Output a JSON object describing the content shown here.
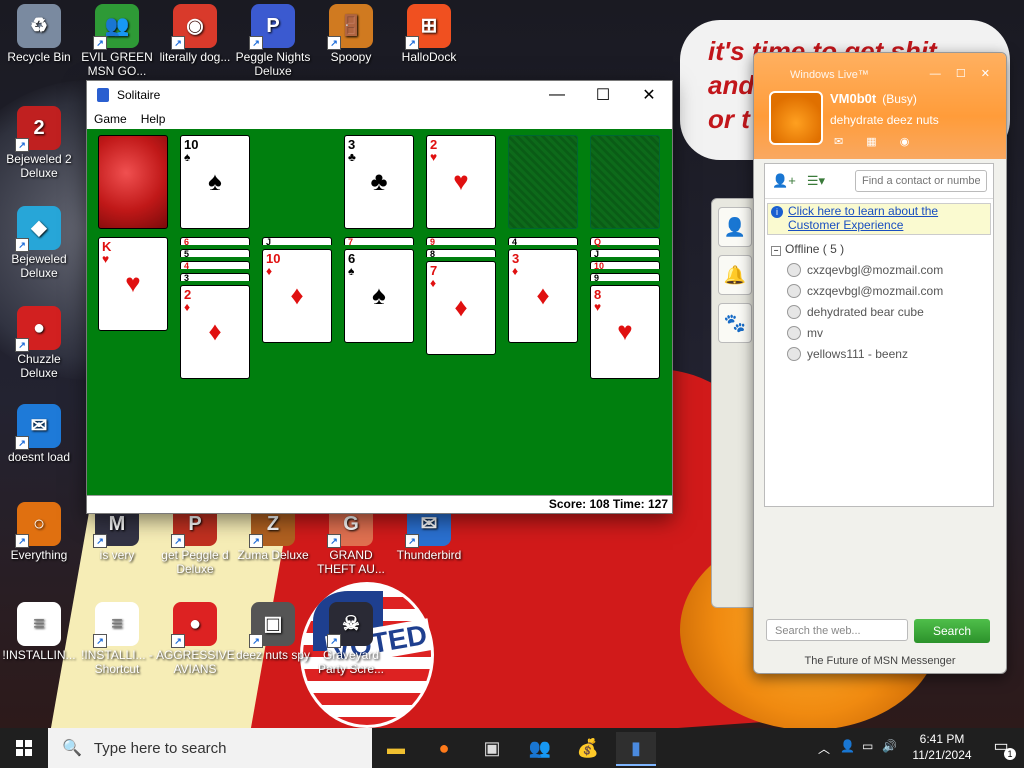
{
  "desktop": {
    "background_text": [
      "it's time to get shit",
      "and",
      "or t"
    ],
    "voted_sticker": "VOTED",
    "icons": [
      {
        "id": "recycle",
        "label": "Recycle Bin",
        "color": "#7a8aa0",
        "glyph": "♻"
      },
      {
        "id": "evil-green",
        "label": "EVIL GREEN MSN GO...",
        "color": "#2e9a36",
        "glyph": "👥"
      },
      {
        "id": "chrome",
        "label": "literally dog...",
        "color": "#d93a2b",
        "glyph": "◉"
      },
      {
        "id": "peggle-nights",
        "label": "Peggle Nights Deluxe",
        "color": "#3b5ad0",
        "glyph": "P"
      },
      {
        "id": "spoopy",
        "label": "Spoopy",
        "color": "#d07a20",
        "glyph": "🚪"
      },
      {
        "id": "hallodock",
        "label": "HalloDock",
        "color": "#f05020",
        "glyph": "⊞"
      },
      {
        "id": "bejeweled2",
        "label": "Bejeweled 2 Deluxe",
        "color": "#c02020",
        "glyph": "2"
      },
      {
        "id": "bejeweled",
        "label": "Bejeweled Deluxe",
        "color": "#27a6d8",
        "glyph": "◆"
      },
      {
        "id": "chuzzle",
        "label": "Chuzzle Deluxe",
        "color": "#d22020",
        "glyph": "●"
      },
      {
        "id": "doesnt-load",
        "label": "doesnt load",
        "color": "#1e7ad8",
        "glyph": "✉"
      },
      {
        "id": "everything",
        "label": "Everything",
        "color": "#e07010",
        "glyph": "○"
      },
      {
        "id": "is-very",
        "label": "is very",
        "color": "#334",
        "glyph": "M"
      },
      {
        "id": "get-peggle",
        "label": "get Peggle d Deluxe",
        "color": "#c03020",
        "glyph": "P"
      },
      {
        "id": "zuma",
        "label": "Zuma Deluxe",
        "color": "#b06020",
        "glyph": "Z"
      },
      {
        "id": "gta",
        "label": "GRAND THEFT AU...",
        "color": "#e07050",
        "glyph": "G"
      },
      {
        "id": "thunderbird",
        "label": "Thunderbird",
        "color": "#2a70d0",
        "glyph": "✉"
      },
      {
        "id": "installing1",
        "label": "!INSTALLIN...",
        "color": "#ffffff",
        "glyph": "≡"
      },
      {
        "id": "installing2",
        "label": "!INSTALLI... - Shortcut",
        "color": "#ffffff",
        "glyph": "≡"
      },
      {
        "id": "aggressive-avians",
        "label": "AGGRESSIVE AVIANS",
        "color": "#d22",
        "glyph": "●"
      },
      {
        "id": "deez-nuts-spy",
        "label": "deez nuts spy",
        "color": "#555",
        "glyph": "▣"
      },
      {
        "id": "graveyard",
        "label": "Graveyard Party Scre...",
        "color": "#2a2a35",
        "glyph": "☠"
      }
    ]
  },
  "solitaire": {
    "title": "Solitaire",
    "menu": [
      "Game",
      "Help"
    ],
    "status": "Score: 108 Time: 127",
    "waste_top": {
      "rank": "10",
      "suit": "♠",
      "color": "blk"
    },
    "foundations": [
      {
        "rank": "3",
        "suit": "♣",
        "color": "blk"
      },
      {
        "rank": "2",
        "suit": "♥",
        "color": "red"
      }
    ],
    "tableau": [
      {
        "tops": [],
        "face": {
          "rank": "K",
          "suit": "♥",
          "color": "red"
        }
      },
      {
        "tops": [
          {
            "rank": "6",
            "suit": "♥",
            "color": "red"
          },
          {
            "rank": "5",
            "suit": "♠",
            "color": "blk"
          },
          {
            "rank": "4",
            "suit": "♦",
            "color": "red"
          },
          {
            "rank": "3",
            "suit": "♠",
            "color": "blk"
          }
        ],
        "face": {
          "rank": "2",
          "suit": "♦",
          "color": "red"
        }
      },
      {
        "tops": [
          {
            "rank": "J",
            "suit": "♣",
            "color": "blk"
          }
        ],
        "face": {
          "rank": "10",
          "suit": "♦",
          "color": "red"
        }
      },
      {
        "tops": [
          {
            "rank": "7",
            "suit": "♥",
            "color": "red"
          }
        ],
        "face": {
          "rank": "6",
          "suit": "♠",
          "color": "blk"
        }
      },
      {
        "tops": [
          {
            "rank": "9",
            "suit": "♦",
            "color": "red"
          },
          {
            "rank": "8",
            "suit": "♠",
            "color": "blk"
          }
        ],
        "face": {
          "rank": "7",
          "suit": "♦",
          "color": "red"
        }
      },
      {
        "tops": [
          {
            "rank": "4",
            "suit": "♠",
            "color": "blk"
          }
        ],
        "face": {
          "rank": "3",
          "suit": "♦",
          "color": "red"
        }
      },
      {
        "tops": [
          {
            "rank": "Q",
            "suit": "♥",
            "color": "red"
          },
          {
            "rank": "J",
            "suit": "♠",
            "color": "blk"
          },
          {
            "rank": "10",
            "suit": "♥",
            "color": "red"
          },
          {
            "rank": "9",
            "suit": "♠",
            "color": "blk"
          }
        ],
        "face": {
          "rank": "8",
          "suit": "♥",
          "color": "red"
        }
      }
    ]
  },
  "msn": {
    "window_title": "Windows Live™",
    "name": "VM0b0t",
    "status": "(Busy)",
    "personal_message": "dehydrate deez nuts",
    "search_contacts_placeholder": "Find a contact or number...",
    "ad_line1": "Click here to learn about the",
    "ad_line2": "Customer Experience",
    "group": "Offline ( 5 )",
    "contacts": [
      "cxzqevbgl@mozmail.com",
      "cxzqevbgl@mozmail.com",
      "dehydrated bear cube",
      "mv",
      "yellows111 - beenz"
    ],
    "web_search_placeholder": "Search the web...",
    "search_button": "Search",
    "footer": "The Future of MSN Messenger"
  },
  "taskbar": {
    "search_placeholder": "Type here to search",
    "time": "6:41 PM",
    "date": "11/21/2024",
    "notification_count": "1"
  }
}
